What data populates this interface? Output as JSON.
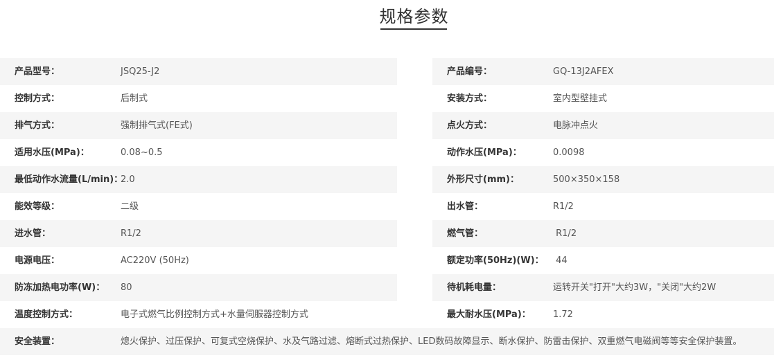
{
  "title": "规格参数",
  "rows": [
    {
      "left": {
        "label": "产品型号：",
        "value": "JSQ25-J2"
      },
      "right": {
        "label": "产品编号：",
        "value": "GQ-13J2AFEX"
      }
    },
    {
      "left": {
        "label": "控制方式：",
        "value": "后制式"
      },
      "right": {
        "label": "安装方式：",
        "value": "室内型壁挂式"
      }
    },
    {
      "left": {
        "label": "排气方式：",
        "value": "强制排气式(FE式)"
      },
      "right": {
        "label": "点火方式：",
        "value": "电脉冲点火"
      }
    },
    {
      "left": {
        "label": "适用水压(MPa)：",
        "value": "0.08~0.5"
      },
      "right": {
        "label": "动作水压(MPa)：",
        "value": "0.0098"
      }
    },
    {
      "left": {
        "label": "最低动作水流量(L/min)：",
        "value": "2.0"
      },
      "right": {
        "label": "外形尺寸(mm)：",
        "value": "500×350×158"
      }
    },
    {
      "left": {
        "label": "能效等级：",
        "value": "二级"
      },
      "right": {
        "label": "出水管：",
        "value": "R1/2"
      }
    },
    {
      "left": {
        "label": "进水管：",
        "value": "R1/2"
      },
      "right": {
        "label": "燃气管：",
        "value": " R1/2"
      }
    },
    {
      "left": {
        "label": "电源电压：",
        "value": "AC220V (50Hz)"
      },
      "right": {
        "label": "额定功率(50Hz)(W)：",
        "value": " 44"
      }
    },
    {
      "left": {
        "label": "防冻加热电功率(W)：",
        "value": "80"
      },
      "right": {
        "label": "待机耗电量：",
        "value": "运转开关\"打开\"大约3W，\"关闭\"大约2W"
      }
    },
    {
      "left": {
        "label": "温度控制方式：",
        "value": "电子式燃气比例控制方式+水量伺服器控制方式"
      },
      "right": {
        "label": "最大耐水压(MPa)：",
        "value": "1.72"
      }
    }
  ],
  "full_row": {
    "label": "安全装置：",
    "value": "熄火保护、过压保护、可复式空烧保护、水及气路过滤、熔断式过热保护、LED数码故障显示、断水保护、防雷击保护、双重燃气电磁阀等等安全保护装置。"
  }
}
